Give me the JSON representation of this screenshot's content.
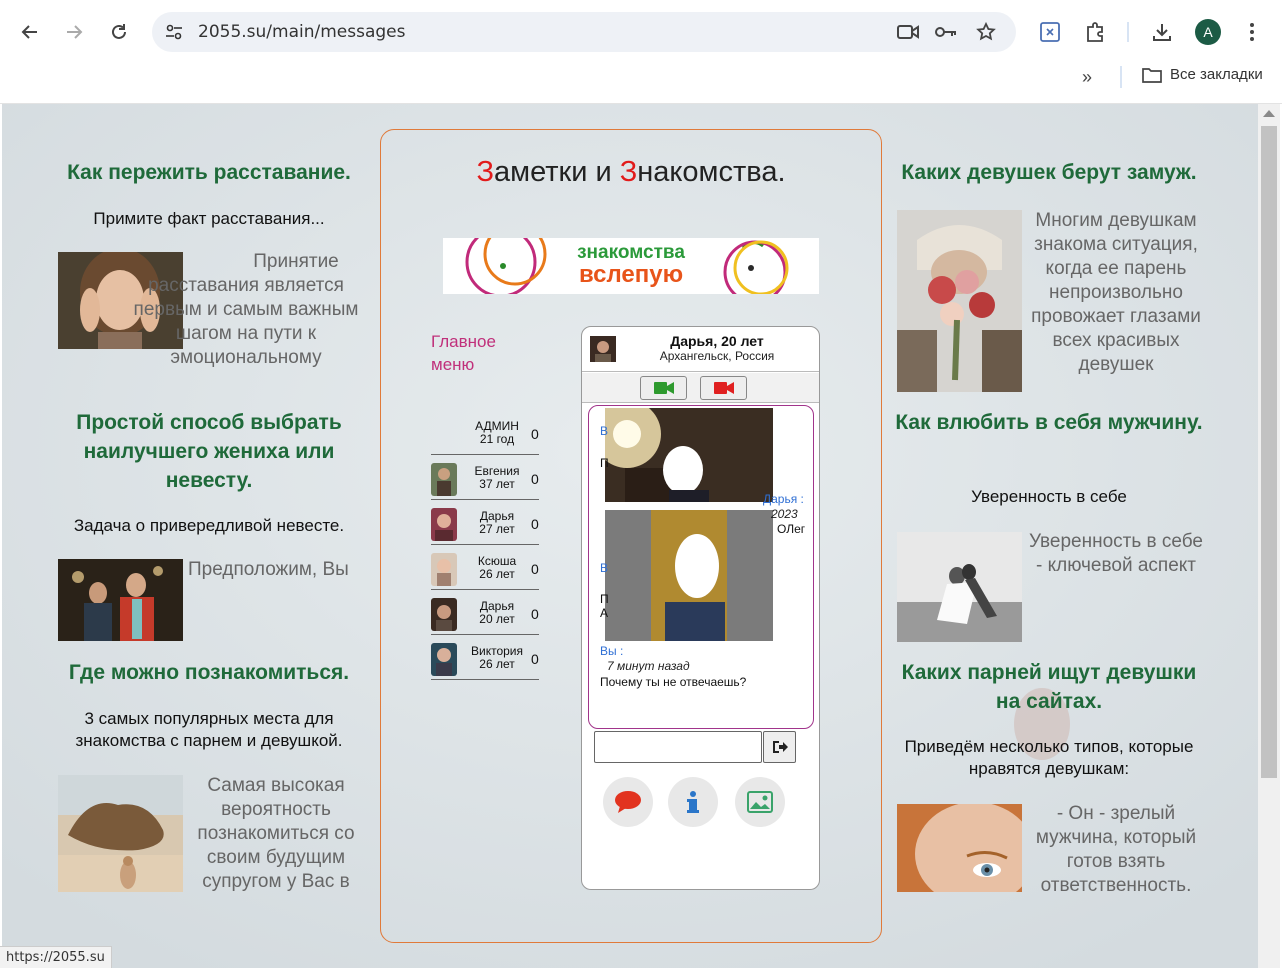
{
  "browser": {
    "url": "2055.su/main/messages",
    "profile_initial": "A",
    "bookmarks_all": "Все закладки",
    "more": "»",
    "status_url": "https://2055.su"
  },
  "left": {
    "a1": {
      "title": "Как пережить расставание.",
      "sub": "Примите факт расставания...",
      "text": "Принятие расставания является первым и самым важным шагом на пути к эмоциональному"
    },
    "a2": {
      "title": "Простой способ выбрать наилучшего жениха или невесту.",
      "sub": "Задача о привередливой невесте.",
      "text": "Предположим, Вы"
    },
    "a3": {
      "title": "Где можно познакомиться.",
      "sub": "3 самых популярных места для знакомства с парнем и девушкой.",
      "text": "Самая высокая вероятность познакомиться со своим будущим супругом у Вас в"
    }
  },
  "right": {
    "a1": {
      "title": "Каких девушек берут замуж.",
      "text": "Многим девушкам знакома ситуация, когда ее парень непроизвольно провожает глазами всех красивых девушек"
    },
    "a2": {
      "title": "Как влюбить в себя мужчину.",
      "sub": "Уверенность в себе",
      "text": "Уверенность в себе - ключевой аспект"
    },
    "a3": {
      "title": "Каких парней ищут девушки на сайтах.",
      "sub": "Приведём несколько типов, которые нравятся девушкам:",
      "text": "- Он - зрелый мужчина, который готов взять ответственность."
    }
  },
  "center": {
    "title_p1_red": "З",
    "title_p1": "аметки и ",
    "title_p2_red": "З",
    "title_p2": "накомства.",
    "banner_text_top": "знакомства",
    "banner_text_bottom": "вслепую",
    "main_menu": "Главное меню",
    "users": [
      {
        "name": "АДМИН",
        "age": "21 год",
        "count": "0"
      },
      {
        "name": "Евгения",
        "age": "37 лет",
        "count": "0"
      },
      {
        "name": "Дарья",
        "age": "27 лет",
        "count": "0"
      },
      {
        "name": "Ксюша",
        "age": "26 лет",
        "count": "0"
      },
      {
        "name": "Дарья",
        "age": "20 лет",
        "count": "0"
      },
      {
        "name": "Виктория",
        "age": "26 лет",
        "count": "0"
      }
    ]
  },
  "chat": {
    "name": "Дарья, 20 лет",
    "location": "Архангельск, Россия",
    "partial_from": "Дарья :",
    "partial_date": "2023",
    "partial_text": "ОЛег",
    "last_from": "Вы :",
    "last_time": "7 минут назад",
    "last_text": "Почему ты не отвечаешь?",
    "input_value": "",
    "colors": {
      "video_green": "#2e9a2e",
      "video_red": "#e02020",
      "border": "#a1348b"
    }
  }
}
